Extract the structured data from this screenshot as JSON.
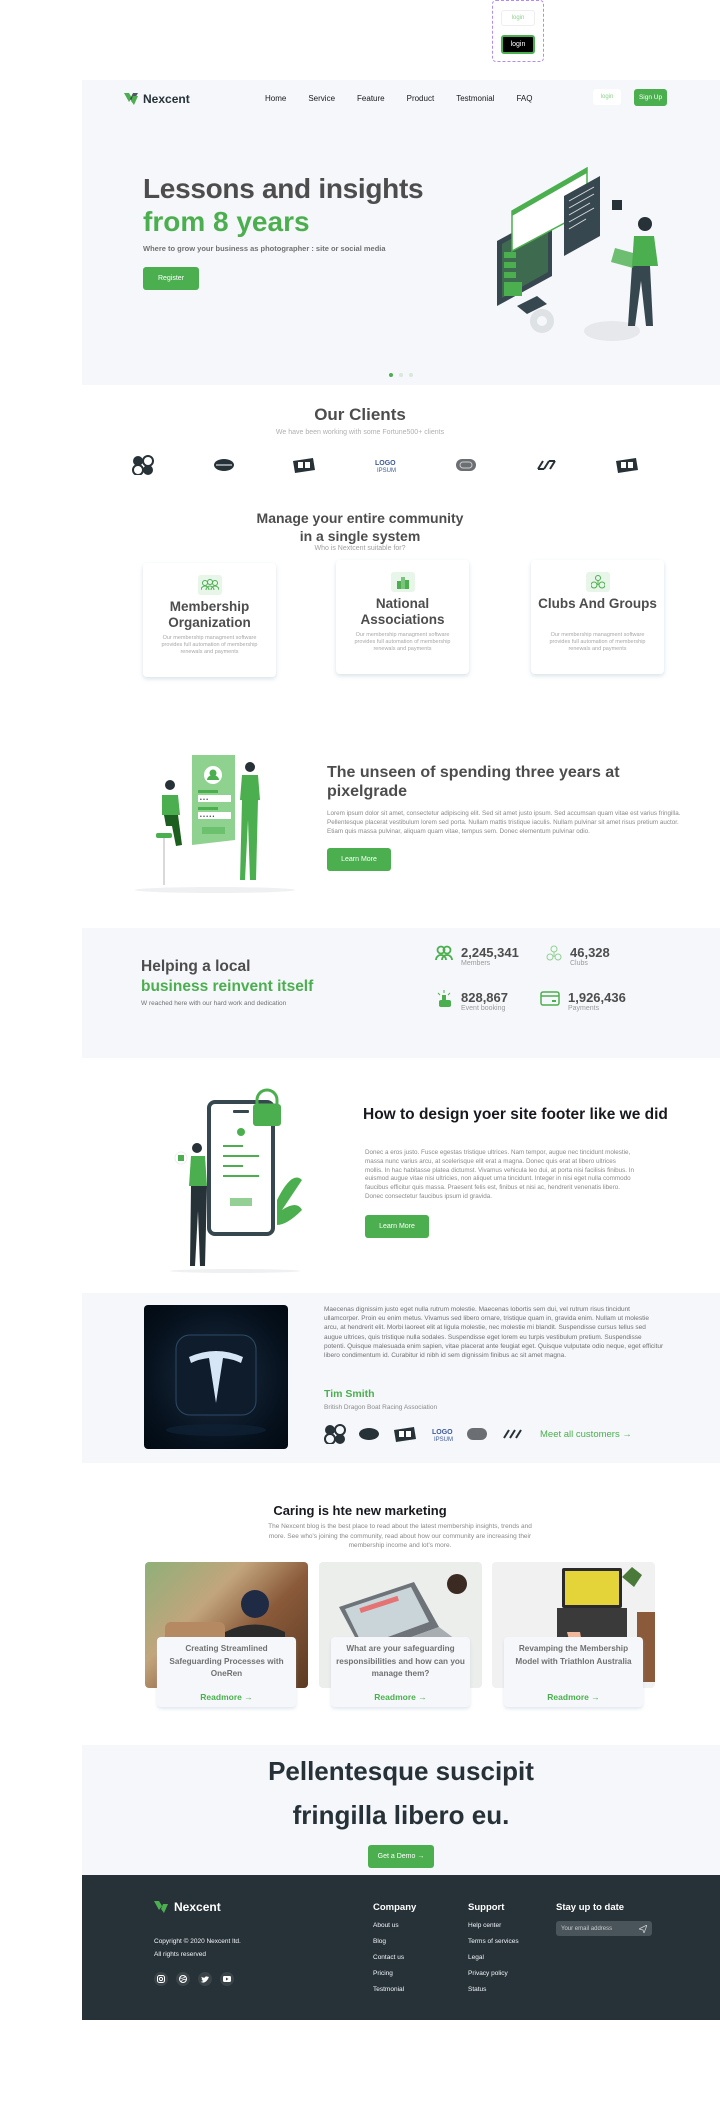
{
  "preview": {
    "login_ghost": "login",
    "login_dark": "login"
  },
  "nav": {
    "brand": "Nexcent",
    "links": [
      "Home",
      "Service",
      "Feature",
      "Product",
      "Testmonial",
      "FAQ"
    ],
    "login": "login",
    "signup": "Sign Up"
  },
  "hero": {
    "title_line1": "Lessons and insights",
    "title_line2": "from 8 years",
    "subtitle": "Where to grow your business as photographer : site or social media",
    "cta": "Register",
    "slides": 3,
    "active_slide": 1
  },
  "clients": {
    "title": "Our Clients",
    "subtitle": "We have been working  with some Fortune500+ clients",
    "logos": [
      "client-logo-1",
      "client-logo-2",
      "client-logo-3",
      "client-logo-4",
      "client-logo-5",
      "client-logo-6",
      "client-logo-7"
    ]
  },
  "community": {
    "title_line1": "Manage your entire community",
    "title_line2": "in  a single  system",
    "subtitle": "Who is Nextcent suitable for?",
    "cards": [
      {
        "icon": "people-icon",
        "title": "Membership Organization",
        "desc": "Our membership managment software provides full automation of membership renewals and payments"
      },
      {
        "icon": "building-icon",
        "title": "National Associations",
        "desc": "Our membership managment software provides full automation of membership renewals and payments"
      },
      {
        "icon": "clubs-icon",
        "title": "Clubs And Groups",
        "desc": "Our membership managment software provides full automation of membership renewals and payments"
      }
    ]
  },
  "unseen": {
    "title": "The unseen of spending three years at pixelgrade",
    "body": "Lorem ipsum dolor sit amet, consectetur adipiscing elit. Sed sit amet justo ipsum. Sed accumsan quam vitae est varius fringilla. Pellentesque placerat vestibulum lorem sed porta. Nullam mattis tristique iaculis. Nullam pulvinar sit amet risus pretium auctor. Etiam quis massa pulvinar, aliquam quam vitae, tempus sem. Donec elementum pulvinar odio.",
    "cta": "Learn More"
  },
  "stats": {
    "title_line1": "Helping a local",
    "title_line2": "business reinvent itself",
    "subtitle": "W reached here with our hard work and dedication",
    "items": [
      {
        "icon": "members-icon",
        "value": "2,245,341",
        "label": "Members"
      },
      {
        "icon": "clubs-icon",
        "value": "46,328",
        "label": "Clubs"
      },
      {
        "icon": "click-icon",
        "value": "828,867",
        "label": "Event booking"
      },
      {
        "icon": "payment-card-icon",
        "value": "1,926,436",
        "label": "Payments"
      }
    ]
  },
  "footer_design": {
    "title": "How to design yoer site footer like we did",
    "body": "Donec a eros justo. Fusce egestas tristique ultrices. Nam tempor, augue nec tincidunt molestie, massa nunc varius arcu, at scelerisque elit erat a magna. Donec quis erat at libero ultrices mollis. In hac habitasse platea dictumst. Vivamus vehicula leo dui, at porta nisi facilisis finibus. In euismod augue vitae nisi ultricies, non aliquet urna tincidunt. Integer in nisi eget nulla commodo faucibus efficitur quis massa. Praesent felis est, finibus et nisi ac, hendrerit venenatis libero. Donec consectetur faucibus ipsum id gravida.",
    "cta": "Learn More"
  },
  "testimonial": {
    "quote": "Maecenas dignissim justo eget nulla rutrum molestie. Maecenas lobortis sem dui, vel rutrum risus tincidunt ullamcorper. Proin eu enim metus. Vivamus sed libero ornare, tristique quam in, gravida enim. Nullam ut molestie arcu, at hendrerit elit. Morbi laoreet elit at ligula molestie, nec molestie mi blandit. Suspendisse cursus tellus sed augue ultrices, quis tristique nulla sodales. Suspendisse eget lorem eu turpis vestibulum pretium. Suspendisse potenti. Quisque malesuada enim sapien, vitae placerat ante feugiat eget. Quisque vulputate odio neque, eget efficitur libero condimentum id. Curabitur id nibh id sem dignissim finibus ac sit amet magna.",
    "name": "Tim Smith",
    "organization": "British Dragon Boat Racing Association",
    "meet_link": "Meet all customers",
    "arrow": "→"
  },
  "blog": {
    "title": "Caring is hte new marketing",
    "subtitle": "The Nexcent blog is the best place to read about the latest membership insights, trends and more. See who's joining the community, read about how our community are increasing their membership income and lot's more.",
    "posts": [
      {
        "title": "Creating Streamlined Safeguarding Processes with OneRen",
        "link": "Readmore →"
      },
      {
        "title": "What are your safeguarding responsibilities and how can you manage them?",
        "link": "Readmore  →"
      },
      {
        "title": "Revamping the Membership Model with Triathlon Australia",
        "link": "Readmore →"
      }
    ]
  },
  "cta": {
    "title_line1": "Pellentesque suscipit",
    "title_line2": "fringilla libero eu.",
    "button": "Get a Demo →"
  },
  "footer": {
    "brand": "Nexcent",
    "copyright": "Copyright © 2020 Nexcent ltd.",
    "rights": "All rights reserved",
    "social": [
      "instagram-icon",
      "dribbble-icon",
      "twitter-icon",
      "youtube-icon"
    ],
    "company": {
      "title": "Company",
      "links": [
        "About us",
        "Blog",
        "Contact us",
        "Pricing",
        "Testmonial"
      ]
    },
    "support": {
      "title": "Support",
      "links": [
        "Help center",
        "Terms of services",
        "Legal",
        "Privacy policy",
        "Status"
      ]
    },
    "newsletter": {
      "title": "Stay up to date",
      "placeholder": "Your email address"
    }
  },
  "colors": {
    "primary": "#4caf4f",
    "dark": "#263238",
    "light_bg": "#f5f7fa",
    "text": "#4d4d4d"
  }
}
